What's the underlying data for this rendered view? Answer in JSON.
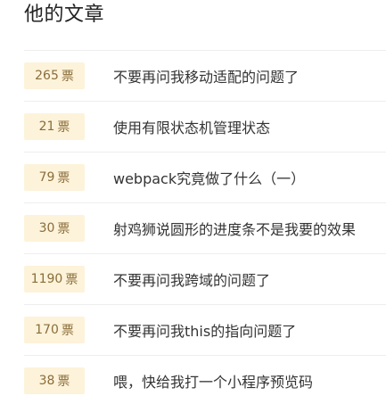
{
  "panel": {
    "title": "他的文章"
  },
  "colors": {
    "badge_background": "#fdf3da",
    "badge_text": "#8a6d3b",
    "divider": "#eeeeee"
  },
  "articles": [
    {
      "votes": "265",
      "unit": "票",
      "title": "不要再问我移动适配的问题了"
    },
    {
      "votes": "21",
      "unit": "票",
      "title": "使用有限状态机管理状态"
    },
    {
      "votes": "79",
      "unit": "票",
      "title": "webpack究竟做了什么（一）"
    },
    {
      "votes": "30",
      "unit": "票",
      "title": "射鸡狮说圆形的进度条不是我要的效果"
    },
    {
      "votes": "1190",
      "unit": "票",
      "title": "不要再问我跨域的问题了"
    },
    {
      "votes": "170",
      "unit": "票",
      "title": "不要再问我this的指向问题了"
    },
    {
      "votes": "38",
      "unit": "票",
      "title": "喂，快给我打一个小程序预览码"
    }
  ]
}
